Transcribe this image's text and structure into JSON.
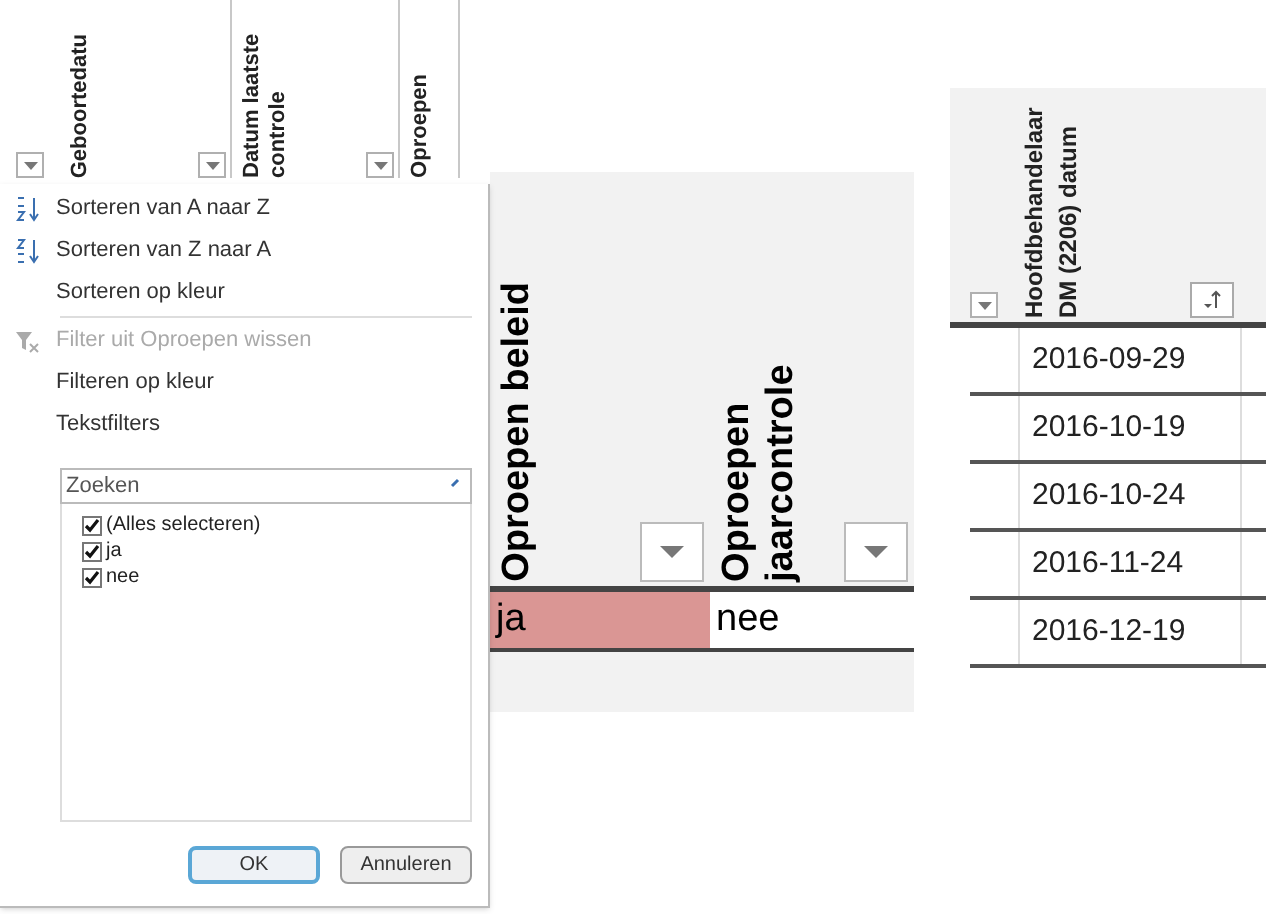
{
  "filter_panel": {
    "columns": [
      {
        "label": "Geboortedatu",
        "dropdown": true
      },
      {
        "label": "Datum laatste controle",
        "dropdown": true
      },
      {
        "label": "Oproepen",
        "dropdown": false
      }
    ],
    "menu": [
      {
        "kind": "sort_asc",
        "label": "Sorteren van A naar Z",
        "disabled": false
      },
      {
        "kind": "sort_desc",
        "label": "Sorteren van Z naar A",
        "disabled": false
      },
      {
        "kind": "plain",
        "label": "Sorteren op kleur",
        "disabled": false
      },
      {
        "kind": "clear_filter",
        "label": "Filter uit Oproepen wissen",
        "disabled": true
      },
      {
        "kind": "plain",
        "label": "Filteren op kleur",
        "disabled": false
      },
      {
        "kind": "plain",
        "label": "Tekstfilters",
        "disabled": false
      }
    ],
    "search": {
      "placeholder": "Zoeken"
    },
    "values": [
      {
        "label": "(Alles selecteren)",
        "checked": true
      },
      {
        "label": "ja",
        "checked": true
      },
      {
        "label": "nee",
        "checked": true
      }
    ],
    "buttons": [
      {
        "label": "OK",
        "kind": "default"
      },
      {
        "label": "Annuleren",
        "kind": "normal"
      }
    ]
  },
  "policy_panel": {
    "columns": [
      {
        "label": "Oproepen beleid"
      },
      {
        "label": "Oproepen jaarcontrole"
      }
    ],
    "row": [
      {
        "value": "ja",
        "highlighted": true
      },
      {
        "value": "nee",
        "highlighted": false
      }
    ]
  },
  "date_panel": {
    "column": {
      "label": "Hoofdbehandelaar DM (2206) datum",
      "sorted": true
    },
    "rows": [
      "2016-09-29",
      "2016-10-19",
      "2016-10-24",
      "2016-11-24",
      "2016-12-19"
    ]
  }
}
